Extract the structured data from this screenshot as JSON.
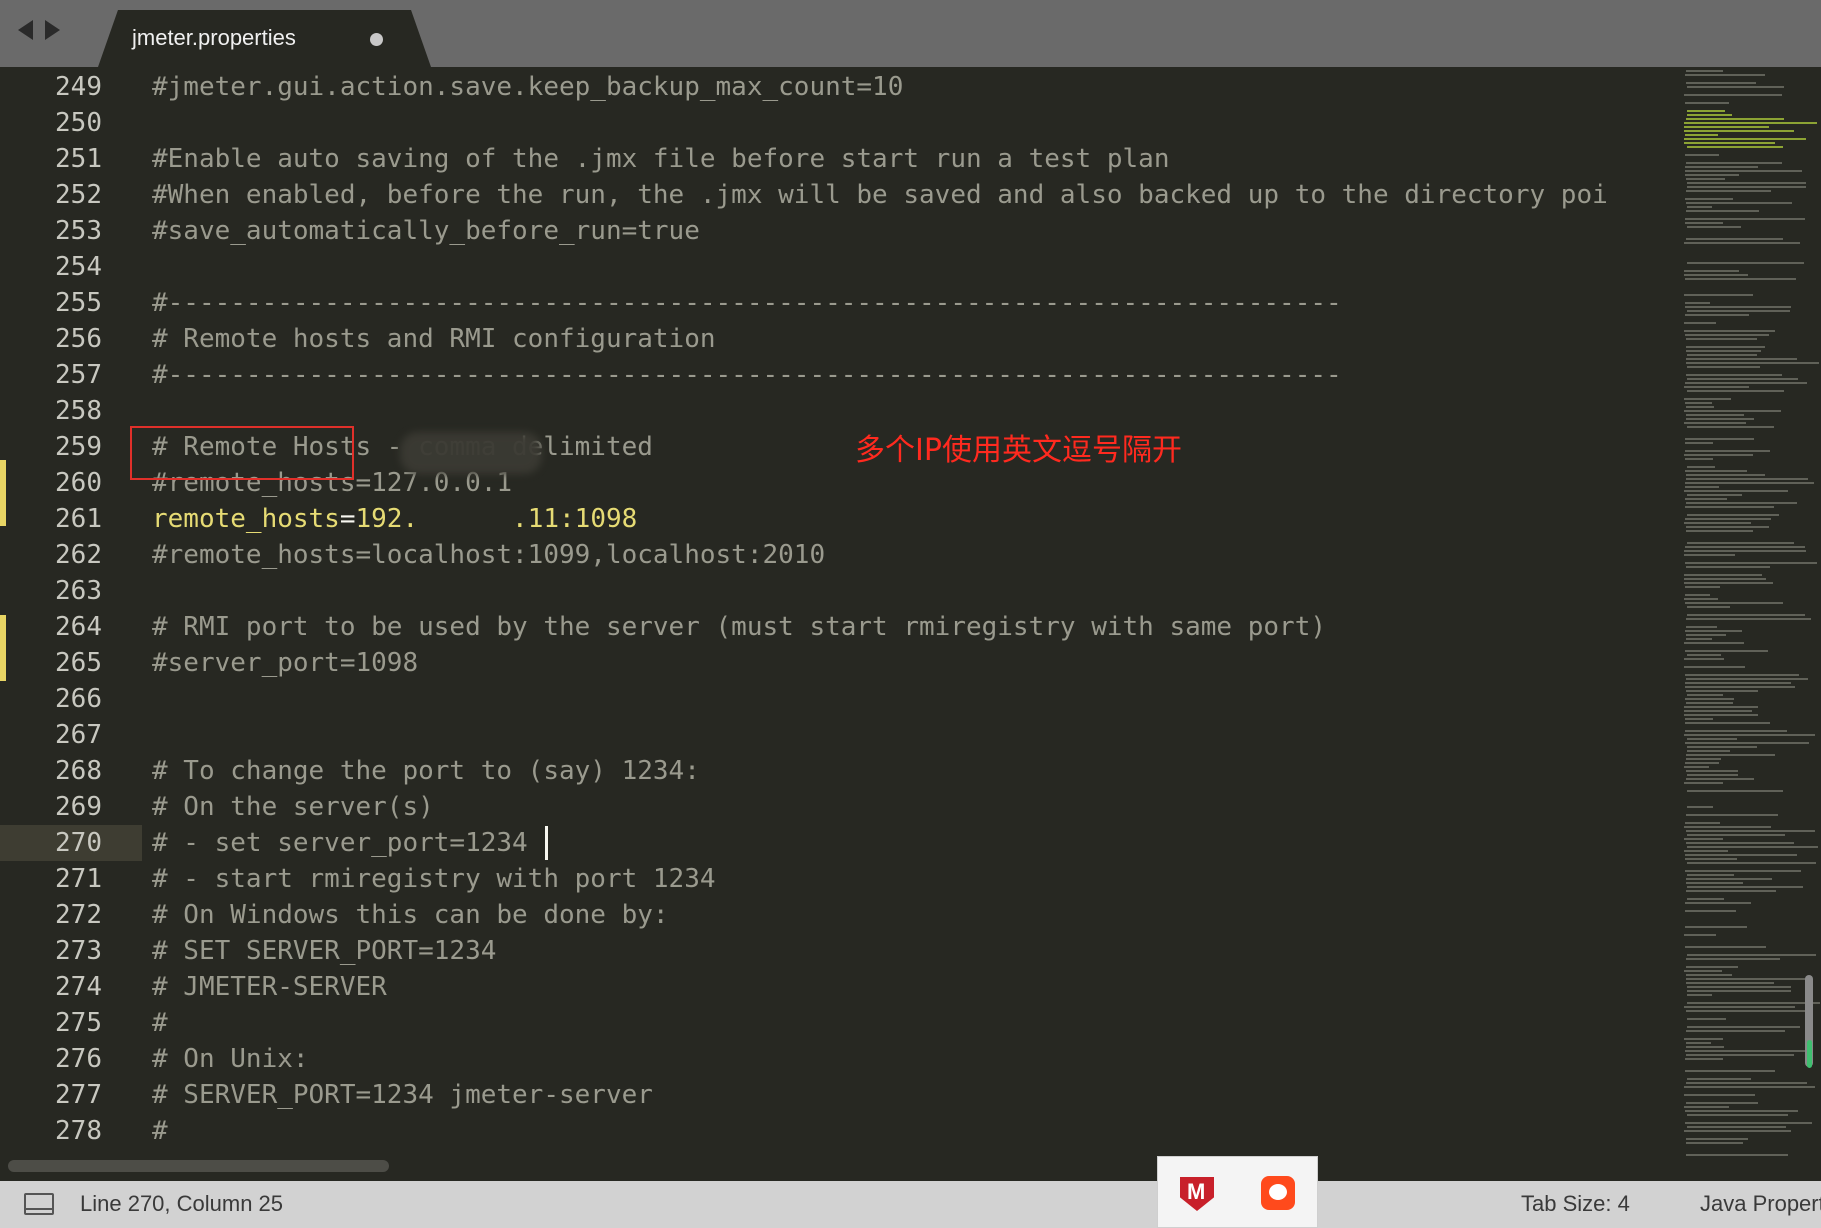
{
  "tab": {
    "title": "jmeter.properties"
  },
  "editor": {
    "lines": [
      {
        "n": "249",
        "text": "#jmeter.gui.action.save.keep_backup_max_count=10"
      },
      {
        "n": "250",
        "text": ""
      },
      {
        "n": "251",
        "text": "#Enable auto saving of the .jmx file before start run a test plan"
      },
      {
        "n": "252",
        "text": "#When enabled, before the run, the .jmx will be saved and also backed up to the directory poi"
      },
      {
        "n": "253",
        "text": "#save_automatically_before_run=true"
      },
      {
        "n": "254",
        "text": ""
      },
      {
        "n": "255",
        "text": "#---------------------------------------------------------------------------"
      },
      {
        "n": "256",
        "text": "# Remote hosts and RMI configuration"
      },
      {
        "n": "257",
        "text": "#---------------------------------------------------------------------------"
      },
      {
        "n": "258",
        "text": ""
      },
      {
        "n": "259",
        "text": "# Remote Hosts - comma delimited"
      },
      {
        "n": "260",
        "text": "#remote_hosts=127.0.0.1"
      },
      {
        "n": "261",
        "text": ""
      },
      {
        "n": "262",
        "text": "#remote_hosts=localhost:1099,localhost:2010"
      },
      {
        "n": "263",
        "text": ""
      },
      {
        "n": "264",
        "text": "# RMI port to be used by the server (must start rmiregistry with same port)"
      },
      {
        "n": "265",
        "text": "#server_port=1098"
      },
      {
        "n": "266",
        "text": ""
      },
      {
        "n": "267",
        "text": ""
      },
      {
        "n": "268",
        "text": "# To change the port to (say) 1234:"
      },
      {
        "n": "269",
        "text": "# On the server(s)"
      },
      {
        "n": "270",
        "text": "# - set server_port=1234"
      },
      {
        "n": "271",
        "text": "# - start rmiregistry with port 1234"
      },
      {
        "n": "272",
        "text": "# On Windows this can be done by:"
      },
      {
        "n": "273",
        "text": "# SET SERVER_PORT=1234"
      },
      {
        "n": "274",
        "text": "# JMETER-SERVER"
      },
      {
        "n": "275",
        "text": "#"
      },
      {
        "n": "276",
        "text": "# On Unix:"
      },
      {
        "n": "277",
        "text": "# SERVER_PORT=1234 jmeter-server"
      },
      {
        "n": "278",
        "text": "#"
      }
    ],
    "active_line": {
      "key": "remote_hosts",
      "equals": "=",
      "value_visible_start": "192.",
      "value_visible_end": ".11:1098"
    },
    "annotation": "多个IP使用英文逗号隔开"
  },
  "status": {
    "position": "Line 270, Column 25",
    "tab_size": "Tab Size: 4",
    "syntax": "Java Propert"
  },
  "colors": {
    "background": "#272822",
    "comment": "#9a9a8e",
    "keyword": "#e6db74",
    "annotation": "#ff2a1f",
    "modified_marker": "#e8d564"
  }
}
